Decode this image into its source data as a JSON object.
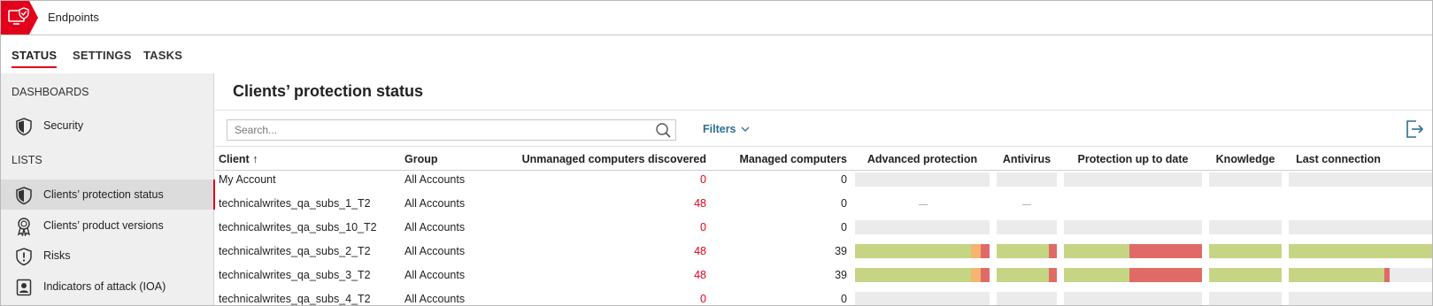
{
  "app": {
    "title": "Endpoints"
  },
  "tabs": [
    {
      "label": "STATUS",
      "active": true
    },
    {
      "label": "SETTINGS",
      "active": false
    },
    {
      "label": "TASKS",
      "active": false
    }
  ],
  "sidebar": {
    "dashboards_title": "DASHBOARDS",
    "lists_title": "LISTS",
    "items": [
      {
        "label": "Security",
        "icon": "shield-icon"
      },
      {
        "label": "Clients’ protection status",
        "icon": "shield-icon",
        "active": true
      },
      {
        "label": "Clients’ product versions",
        "icon": "award-icon"
      },
      {
        "label": "Risks",
        "icon": "warning-shield-icon"
      },
      {
        "label": "Indicators of attack (IOA)",
        "icon": "user-badge-icon"
      }
    ]
  },
  "main": {
    "title": "Clients’ protection status",
    "search_placeholder": "Search...",
    "filters_label": "Filters",
    "columns": {
      "client": "Client ↑",
      "group": "Group",
      "unmanaged": "Unmanaged computers discovered",
      "managed": "Managed computers",
      "advanced": "Advanced protection",
      "antivirus": "Antivirus",
      "uptodate": "Protection up to date",
      "knowledge": "Knowledge",
      "lastconn": "Last connection"
    },
    "rows": [
      {
        "client": "My Account",
        "group": "All Accounts",
        "unmanaged": "0",
        "managed": "0"
      },
      {
        "client": "technicalwrites_qa_subs_1_T2",
        "group": "All Accounts",
        "unmanaged": "48",
        "managed": "0"
      },
      {
        "client": "technicalwrites_qa_subs_10_T2",
        "group": "All Accounts",
        "unmanaged": "0",
        "managed": "0"
      },
      {
        "client": "technicalwrites_qa_subs_2_T2",
        "group": "All Accounts",
        "unmanaged": "48",
        "managed": "39"
      },
      {
        "client": "technicalwrites_qa_subs_3_T2",
        "group": "All Accounts",
        "unmanaged": "48",
        "managed": "39"
      },
      {
        "client": "technicalwrites_qa_subs_4_T2",
        "group": "All Accounts",
        "unmanaged": "0",
        "managed": "0"
      }
    ]
  },
  "colors": {
    "accent": "#e3001b",
    "link": "#2c6e93",
    "bar_green": "#c5d584",
    "bar_orange": "#f5b56f",
    "bar_red": "#e06b66",
    "bar_empty": "#ebebeb"
  }
}
